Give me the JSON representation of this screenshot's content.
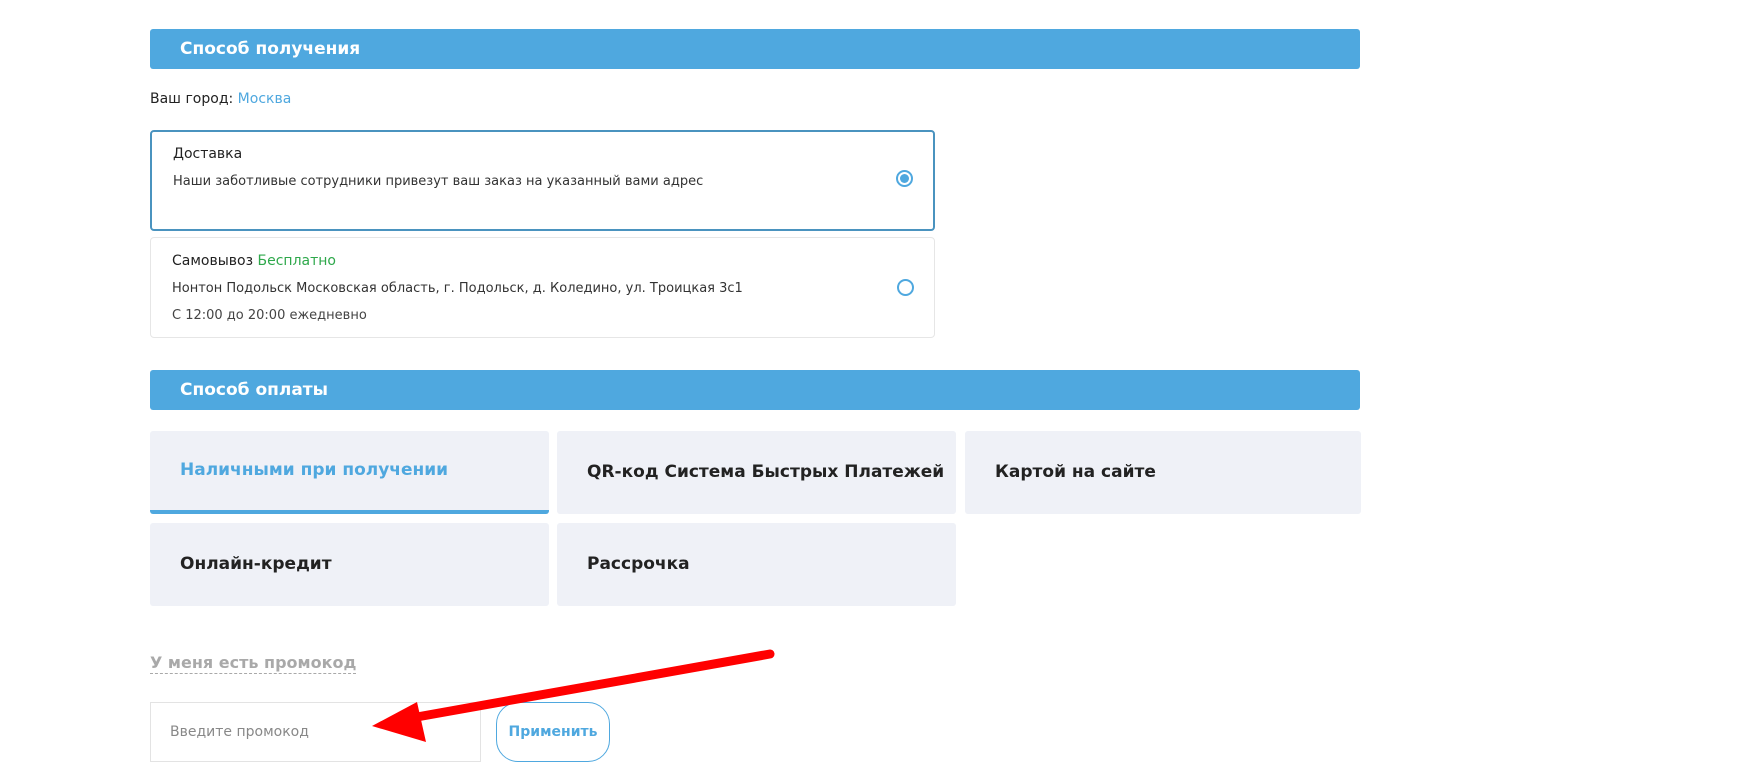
{
  "receive": {
    "header": "Способ получения",
    "city_label": "Ваш город:",
    "city_value": "Москва",
    "options": [
      {
        "title": "Доставка",
        "description": "Наши заботливые сотрудники привезут ваш заказ на указанный вами адрес",
        "selected": true
      },
      {
        "title": "Самовывоз",
        "badge": "Бесплатно",
        "address": "Нонтон Подольск Московская область, г. Подольск, д. Коледино, ул. Троицкая 3с1",
        "hours": "С 12:00 до 20:00 ежедневно",
        "selected": false
      }
    ]
  },
  "payment": {
    "header": "Способ оплаты",
    "methods": [
      {
        "label": "Наличными при получении",
        "active": true
      },
      {
        "label": "QR-код Система Быстрых Платежей",
        "active": false
      },
      {
        "label": "Картой на сайте",
        "active": false
      },
      {
        "label": "Онлайн-кредит",
        "active": false
      },
      {
        "label": "Рассрочка",
        "active": false
      }
    ]
  },
  "promo": {
    "toggle_label": "У меня есть промокод",
    "input_value": "",
    "input_placeholder": "Введите промокод",
    "apply_label": "Применить"
  },
  "colors": {
    "accent": "#4fa8df",
    "free_green": "#2ea84b",
    "tile_bg": "#eff1f7",
    "annotation_red": "#ff0000"
  }
}
